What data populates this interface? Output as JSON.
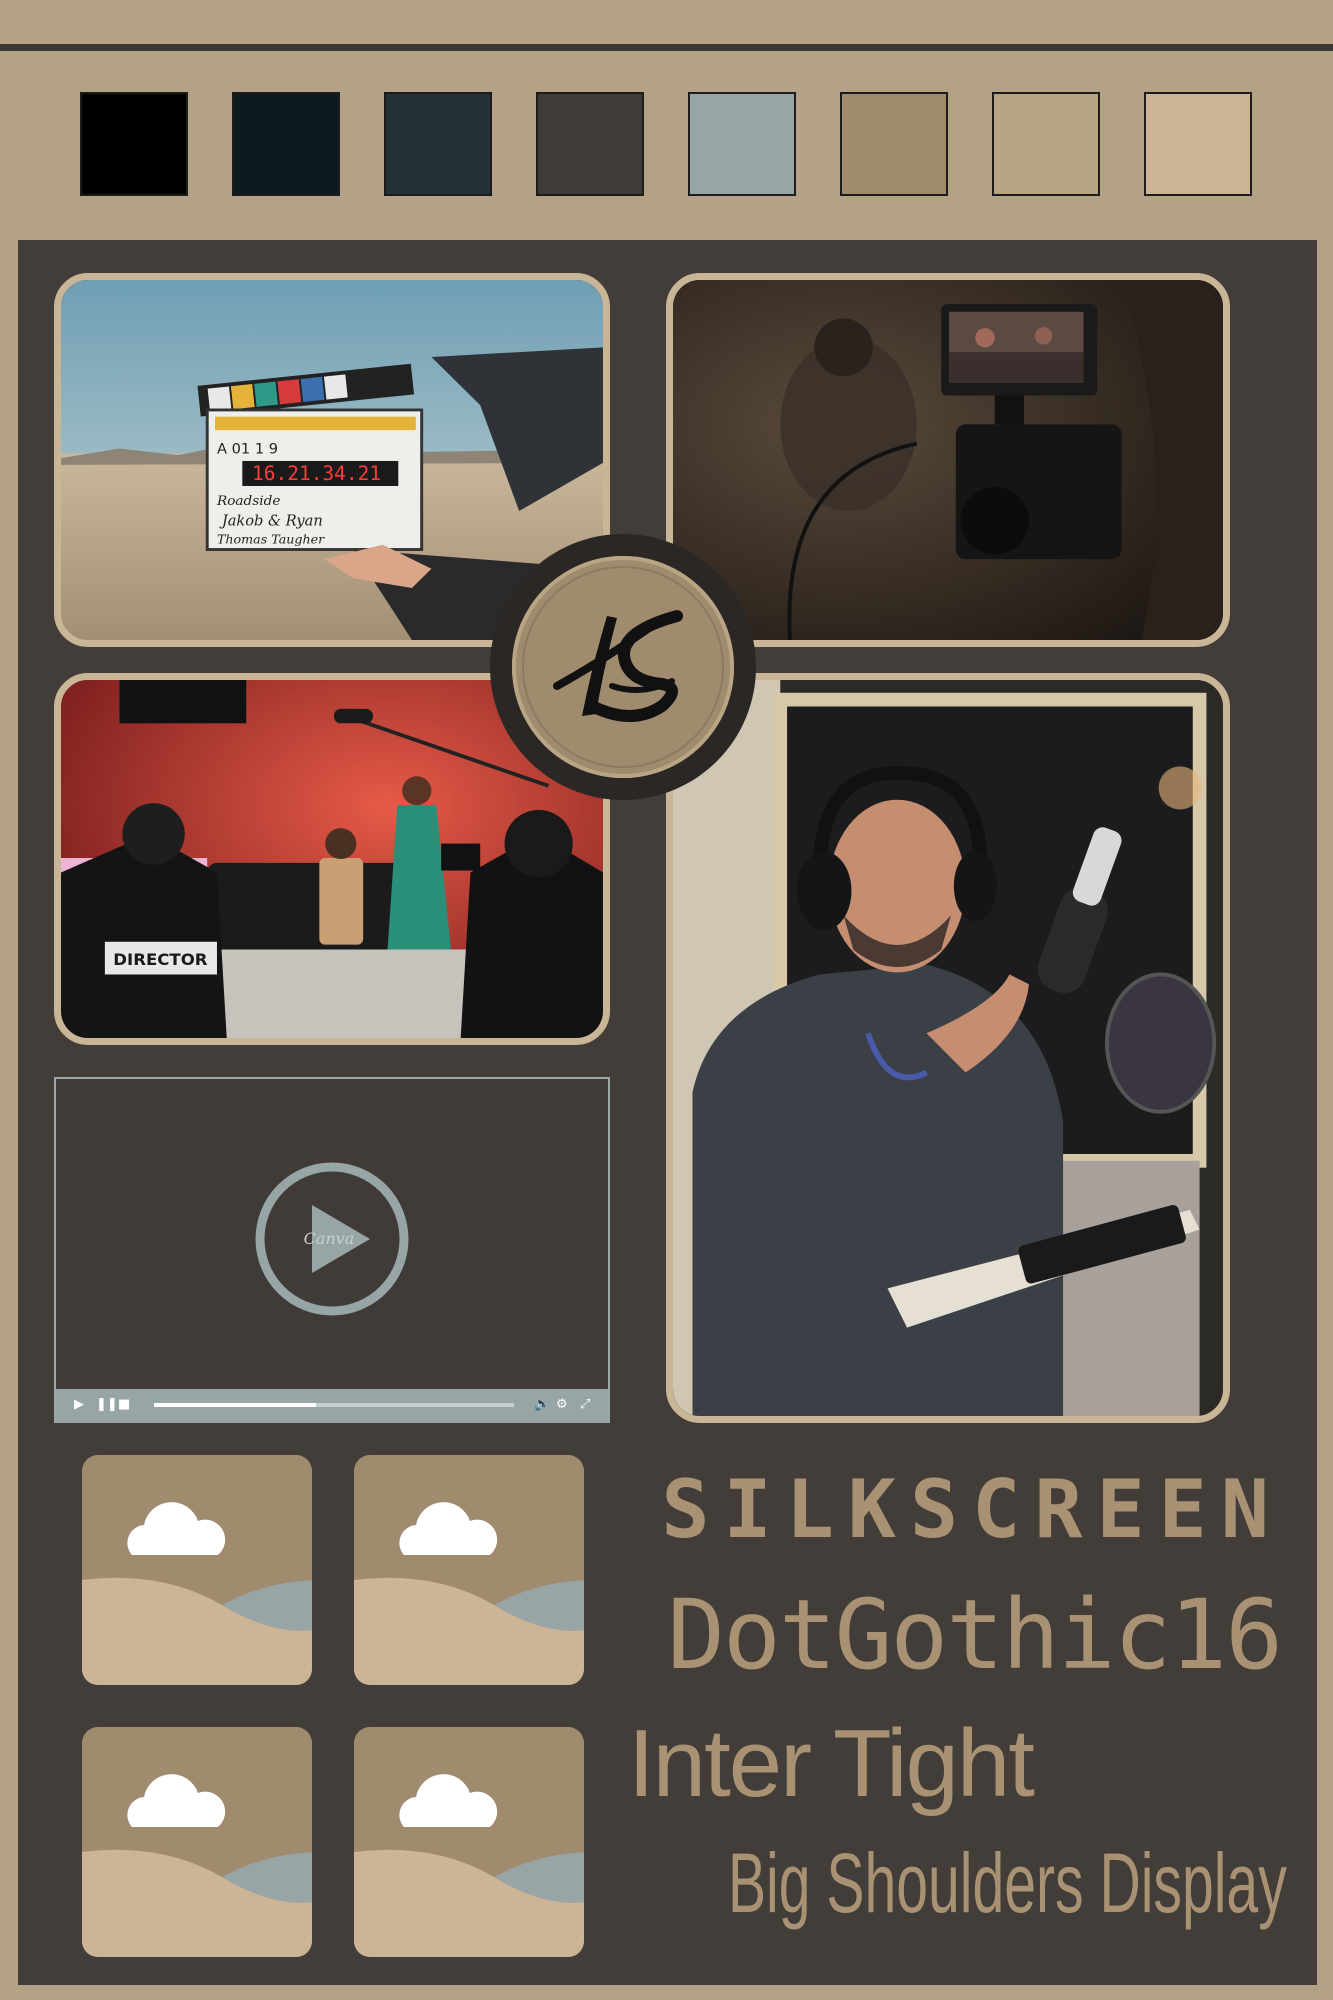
{
  "palette": {
    "swatches": [
      "#000000",
      "#0d1a1e",
      "#243137",
      "#403b38",
      "#98a5a7",
      "#a08b6f",
      "#b8a584",
      "#ccb596"
    ]
  },
  "board": {
    "background": "#423d38",
    "frame_color": "#c9b697"
  },
  "photos": [
    {
      "name": "clapperboard-desert-photo",
      "clapper_text": [
        "A 01",
        "1",
        "9",
        "16.21.34.21",
        "Roadside",
        "Jakob & Ryan",
        "Thomas Taugher"
      ]
    },
    {
      "name": "camera-monitor-photo"
    },
    {
      "name": "film-set-red-studio-photo",
      "chair_label": "DIRECTOR"
    },
    {
      "name": "voiceover-recording-photo"
    }
  ],
  "player": {
    "watermark": "Canva",
    "progress": 0.45,
    "controls": [
      "play",
      "pause",
      "stop",
      "volume",
      "settings",
      "fullscreen"
    ]
  },
  "fonts": {
    "sample1": "SILKSCREEN",
    "sample2": "DotGothic16",
    "sample3": "Inter Tight",
    "sample4": "Big Shoulders Display"
  }
}
